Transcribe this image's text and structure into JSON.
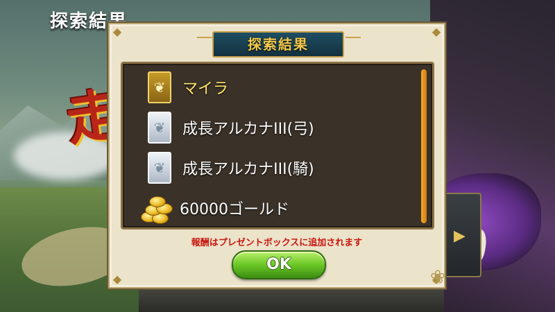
{
  "background": {
    "screen_title": "探索結果",
    "banner_glyph": "走",
    "side_arrow": "▶"
  },
  "dialog": {
    "title": "探索結果",
    "items": [
      {
        "label": "マイラ",
        "icon": "gold-arcana-card-icon",
        "label_color": "#ffe56a"
      },
      {
        "label": "成長アルカナIII(弓)",
        "icon": "silver-arcana-card-icon",
        "label_color": "#ffffff"
      },
      {
        "label": "成長アルカナIII(騎)",
        "icon": "silver-arcana-card-icon",
        "label_color": "#ffffff"
      },
      {
        "label": "60000ゴールド",
        "icon": "gold-coins-icon",
        "label_color": "#ffffff"
      }
    ],
    "notice": "報酬はプレゼントボックスに追加されます",
    "ok_label": "OK"
  },
  "colors": {
    "ok_button": "#6ac626",
    "notice_text": "#c7170f",
    "title_text": "#f3c84a",
    "scroll_thumb": "#f2a52b"
  }
}
